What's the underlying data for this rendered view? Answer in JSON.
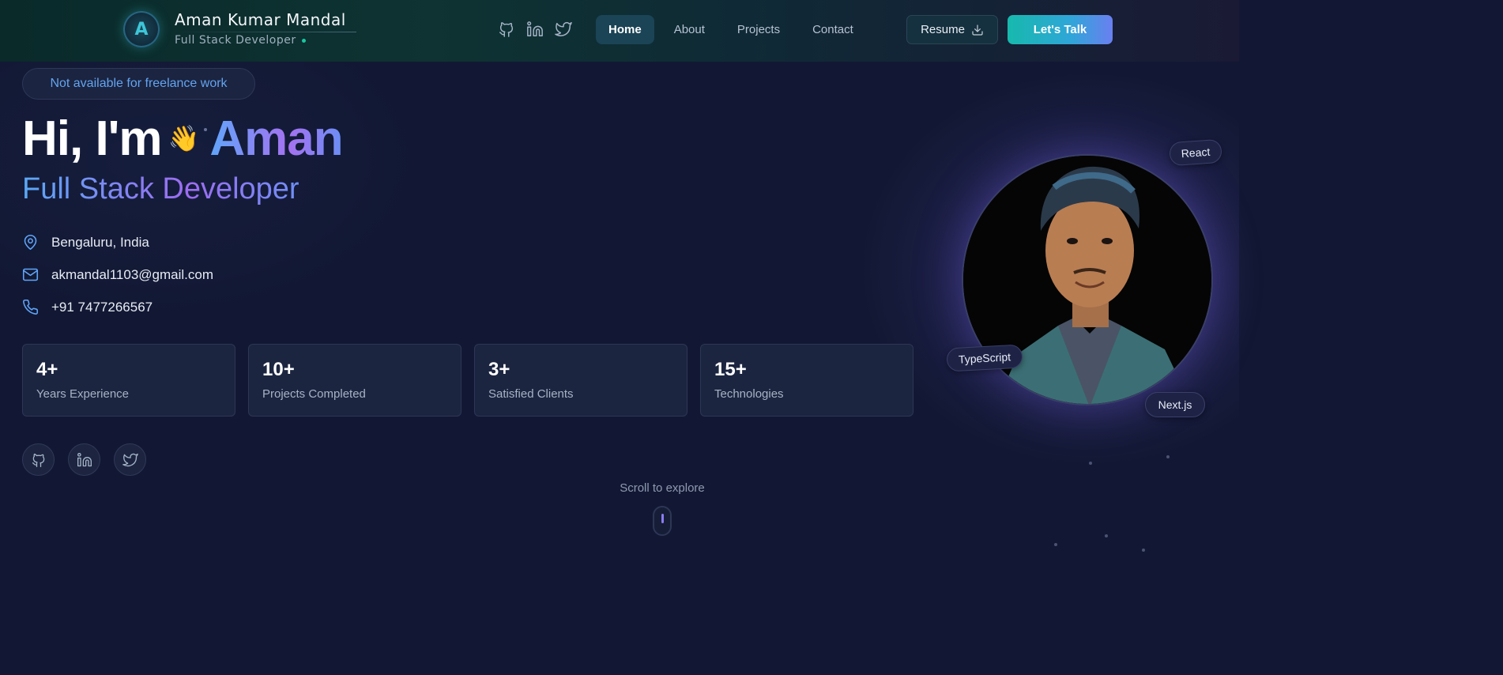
{
  "header": {
    "logo_letter": "A",
    "brand_name": "Aman Kumar Mandal",
    "brand_subtitle": "Full Stack Developer",
    "social_icons": [
      "github-icon",
      "linkedin-icon",
      "twitter-icon"
    ],
    "nav": [
      {
        "label": "Home",
        "active": true
      },
      {
        "label": "About",
        "active": false
      },
      {
        "label": "Projects",
        "active": false
      },
      {
        "label": "Contact",
        "active": false
      }
    ],
    "resume_label": "Resume",
    "talk_label": "Let's Talk"
  },
  "hero": {
    "availability": "Not available for freelance work",
    "greeting": "Hi, I'm",
    "wave": "👋",
    "name": "Aman",
    "role": "Full Stack Developer",
    "location": "Bengaluru, India",
    "email": "akmandal1103@gmail.com",
    "phone": "+91 7477266567",
    "stats": [
      {
        "value": "4+",
        "label": "Years Experience"
      },
      {
        "value": "10+",
        "label": "Projects Completed"
      },
      {
        "value": "3+",
        "label": "Satisfied Clients"
      },
      {
        "value": "15+",
        "label": "Technologies"
      }
    ],
    "scroll_hint": "Scroll to explore"
  },
  "avatar": {
    "tags": [
      "React",
      "TypeScript",
      "Next.js"
    ]
  },
  "colors": {
    "background": "#121833",
    "accent_blue": "#60a5fa",
    "accent_purple": "#a472f0",
    "accent_teal": "#17b9ad"
  }
}
